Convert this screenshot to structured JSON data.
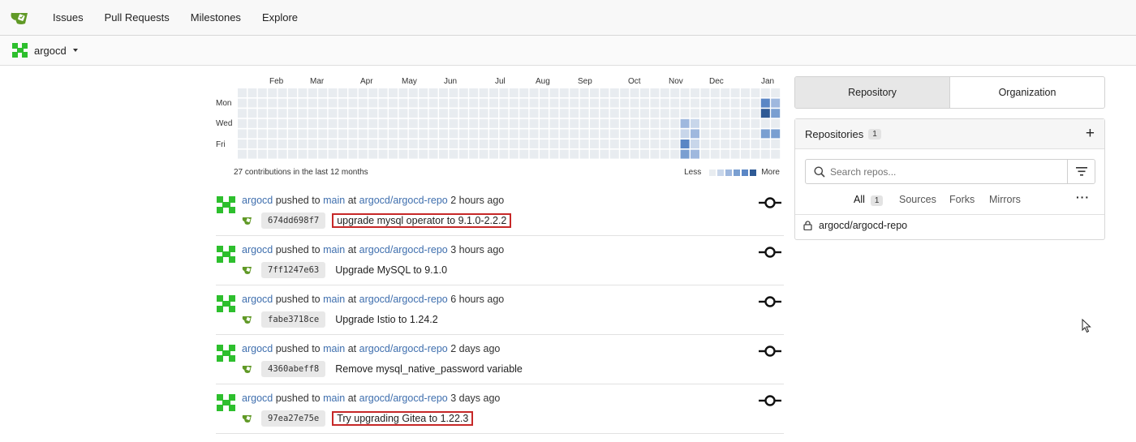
{
  "nav": {
    "logo_icon": "gitea-teacup-icon",
    "items": [
      "Issues",
      "Pull Requests",
      "Milestones",
      "Explore"
    ]
  },
  "context": {
    "name": "argocd"
  },
  "heatmap": {
    "months": [
      "Feb",
      "Mar",
      "Apr",
      "May",
      "Jun",
      "Jul",
      "Aug",
      "Sep",
      "Oct",
      "Nov",
      "Dec",
      "Jan"
    ],
    "days": [
      "Mon",
      "Wed",
      "Fri"
    ],
    "total": "27 contributions in the last 12 months",
    "legend_less": "Less",
    "legend_more": "More",
    "colors": [
      "#e8ecf0",
      "#c8d6ea",
      "#9fb8de",
      "#7a9fd1",
      "#5a86c5",
      "#2f5a95"
    ]
  },
  "feed": [
    {
      "user": "argocd",
      "action": "pushed to",
      "branch": "main",
      "at": "at",
      "repo": "argocd/argocd-repo",
      "time": "2 hours ago",
      "sha": "674dd698f7",
      "message": "upgrade mysql operator to 9.1.0-2.2.2",
      "highlighted": true
    },
    {
      "user": "argocd",
      "action": "pushed to",
      "branch": "main",
      "at": "at",
      "repo": "argocd/argocd-repo",
      "time": "3 hours ago",
      "sha": "7ff1247e63",
      "message": "Upgrade MySQL to 9.1.0",
      "highlighted": false
    },
    {
      "user": "argocd",
      "action": "pushed to",
      "branch": "main",
      "at": "at",
      "repo": "argocd/argocd-repo",
      "time": "6 hours ago",
      "sha": "fabe3718ce",
      "message": "Upgrade Istio to 1.24.2",
      "highlighted": false
    },
    {
      "user": "argocd",
      "action": "pushed to",
      "branch": "main",
      "at": "at",
      "repo": "argocd/argocd-repo",
      "time": "2 days ago",
      "sha": "4360abeff8",
      "message": "Remove mysql_native_password variable",
      "highlighted": false
    },
    {
      "user": "argocd",
      "action": "pushed to",
      "branch": "main",
      "at": "at",
      "repo": "argocd/argocd-repo",
      "time": "3 days ago",
      "sha": "97ea27e75e",
      "message": "Try upgrading Gitea to 1.22.3",
      "highlighted": true
    }
  ],
  "panel": {
    "tabs": [
      "Repository",
      "Organization"
    ],
    "title": "Repositories",
    "count": "1",
    "search_placeholder": "Search repos...",
    "subtabs": {
      "all": "All",
      "all_count": "1",
      "sources": "Sources",
      "forks": "Forks",
      "mirrors": "Mirrors"
    },
    "repos": [
      "argocd/argocd-repo"
    ]
  }
}
